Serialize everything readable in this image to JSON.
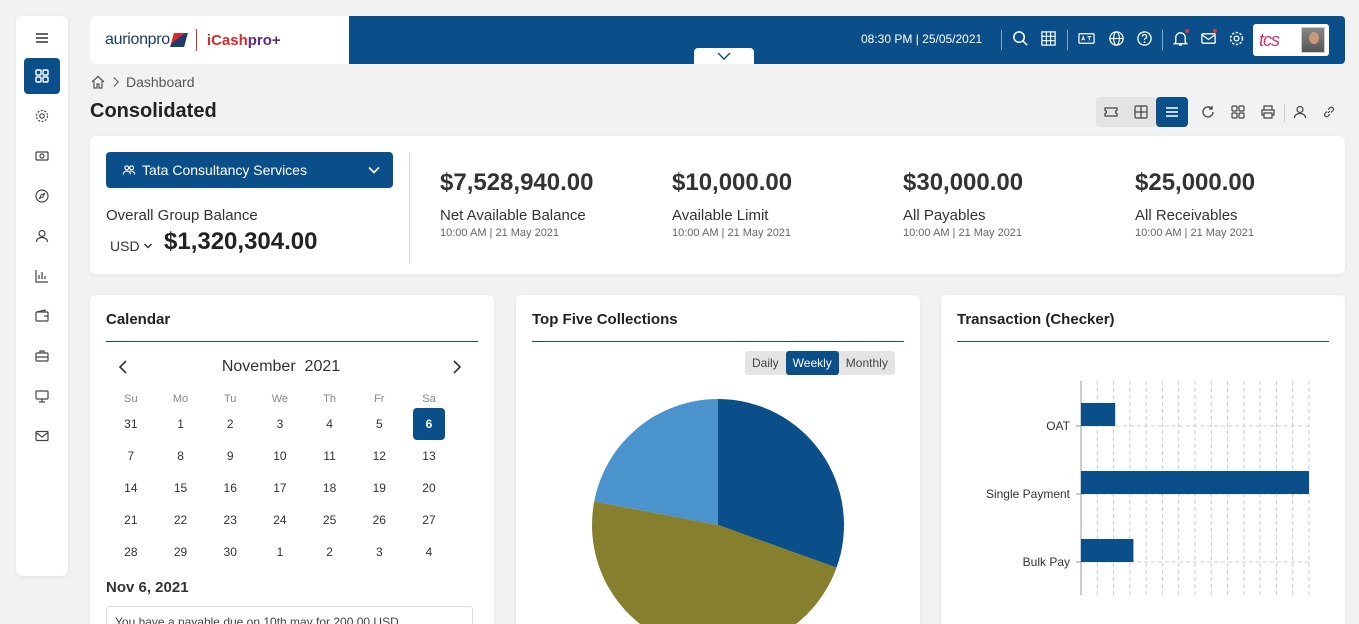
{
  "header": {
    "logo_left": "aurionpro",
    "logo_right_a": "iCash",
    "logo_right_b": "pro+",
    "datetime": "08:30 PM | 25/05/2021",
    "brand_badge": "tcs"
  },
  "sidebar": {
    "items": [
      {
        "icon": "menu-icon"
      },
      {
        "icon": "dashboard-icon"
      },
      {
        "icon": "settings-icon"
      },
      {
        "icon": "cash-icon"
      },
      {
        "icon": "compass-icon"
      },
      {
        "icon": "user-icon"
      },
      {
        "icon": "report-icon"
      },
      {
        "icon": "wallet-icon"
      },
      {
        "icon": "briefcase-icon"
      },
      {
        "icon": "monitor-icon"
      },
      {
        "icon": "mail-icon"
      }
    ]
  },
  "breadcrumb": {
    "current": "Dashboard"
  },
  "page": {
    "title": "Consolidated"
  },
  "summary": {
    "company": "Tata Consultancy Services",
    "overall_label": "Overall Group Balance",
    "currency": "USD",
    "overall_value": "$1,320,304.00",
    "metrics": [
      {
        "value": "$7,528,940.00",
        "label": "Net Available Balance",
        "time": "10:00 AM | 21 May 2021"
      },
      {
        "value": "$10,000.00",
        "label": "Available Limit",
        "time": "10:00 AM | 21 May 2021"
      },
      {
        "value": "$30,000.00",
        "label": "All Payables",
        "time": "10:00 AM | 21 May 2021"
      },
      {
        "value": "$25,000.00",
        "label": "All Receivables",
        "time": "10:00 AM | 21 May 2021"
      }
    ]
  },
  "calendar": {
    "title": "Calendar",
    "month": "November",
    "year": "2021",
    "weekdays": [
      "Su",
      "Mo",
      "Tu",
      "We",
      "Th",
      "Fr",
      "Sa"
    ],
    "weeks": [
      [
        "31",
        "1",
        "2",
        "3",
        "4",
        "5",
        "6"
      ],
      [
        "7",
        "8",
        "9",
        "10",
        "11",
        "12",
        "13"
      ],
      [
        "14",
        "15",
        "16",
        "17",
        "18",
        "19",
        "20"
      ],
      [
        "21",
        "22",
        "23",
        "24",
        "25",
        "26",
        "27"
      ],
      [
        "28",
        "29",
        "30",
        "1",
        "2",
        "3",
        "4"
      ]
    ],
    "selected": "6",
    "selected_date": "Nov 6, 2021",
    "note": "You have a payable due on 10th may for 200.00 USD"
  },
  "collections": {
    "title": "Top Five Collections",
    "periods": [
      "Daily",
      "Weekly",
      "Monthly"
    ],
    "active_period": "Weekly",
    "colors": [
      "#0b4f8a",
      "#857f2e",
      "#4a93cc"
    ]
  },
  "transactions": {
    "title": "Transaction (Checker)",
    "bar_color": "#0b4f8a"
  },
  "chart_data": [
    {
      "type": "pie",
      "title": "Top Five Collections",
      "categories": [
        "",
        "",
        ""
      ],
      "values": [
        30.5,
        47.5,
        22
      ]
    },
    {
      "type": "bar",
      "orientation": "horizontal",
      "title": "Transaction (Checker)",
      "categories": [
        "OAT",
        "Single Payment",
        "Bulk Pay"
      ],
      "values": [
        1.5,
        10,
        2.3
      ],
      "xlim": [
        0,
        10
      ],
      "grid": true
    }
  ]
}
